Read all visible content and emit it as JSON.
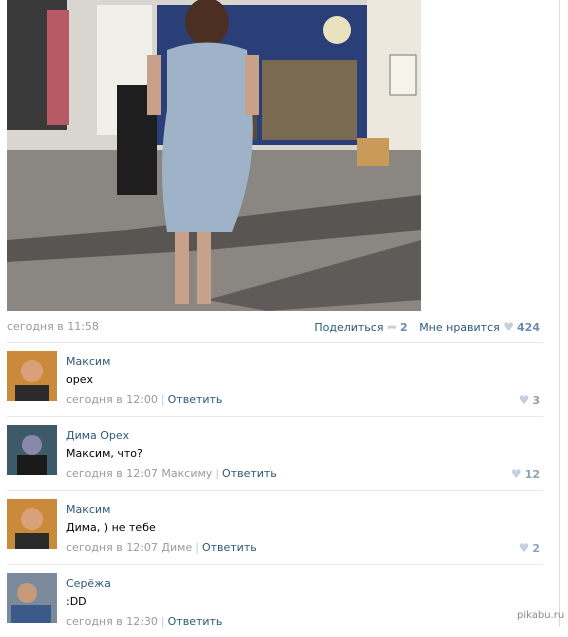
{
  "post": {
    "date": "сегодня в 11:58",
    "share_label": "Поделиться",
    "share_count": "2",
    "like_label": "Мне нравится",
    "like_count": "424"
  },
  "comments": [
    {
      "author": "Максим",
      "text": "орех",
      "time": "сегодня в 12:00",
      "to": "",
      "reply_label": "Ответить",
      "likes": "3"
    },
    {
      "author": "Дима Орех",
      "text": "Максим, что?",
      "time": "сегодня в 12:07",
      "to": "Максиму",
      "reply_label": "Ответить",
      "likes": "12"
    },
    {
      "author": "Максим",
      "text": "Дима, ) не тебе",
      "time": "сегодня в 12:07",
      "to": "Диме",
      "reply_label": "Ответить",
      "likes": "2"
    },
    {
      "author": "Серёжа",
      "text": ":DD",
      "time": "сегодня в 12:30",
      "to": "",
      "reply_label": "Ответить",
      "likes": ""
    }
  ],
  "watermark": "pikabu.ru",
  "colors": {
    "link": "#2B587A",
    "meta": "#999999",
    "divider": "#E7EAED"
  }
}
